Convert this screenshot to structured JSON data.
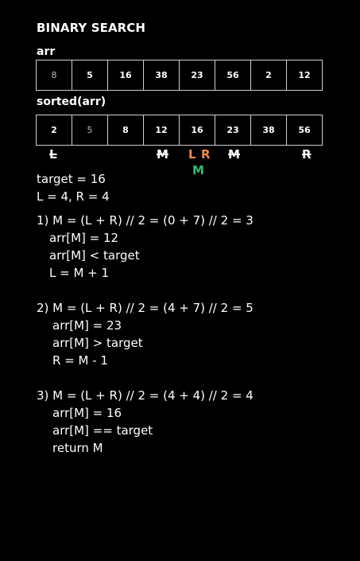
{
  "title": "BINARY SEARCH",
  "arr_label": "arr",
  "sorted_label": "sorted(arr)",
  "arr": [
    "8",
    "5",
    "16",
    "38",
    "23",
    "56",
    "2",
    "12"
  ],
  "sorted": [
    "2",
    "5",
    "8",
    "12",
    "16",
    "23",
    "38",
    "56"
  ],
  "markers": {
    "l_old": "L",
    "m_old1": "M",
    "l_new": "L",
    "r_new": "R",
    "m_final": "M",
    "m_old2": "M",
    "r_old": "R"
  },
  "colors": {
    "orange": "#f08a4b",
    "green": "#2fbf71"
  },
  "target_line": "target = 16",
  "lr_line": "L = 4, R = 4",
  "steps": [
    {
      "head": "1) M = (L + R) // 2 = (0 + 7) // 2 = 3",
      "lines": [
        "arr[M] = 12",
        "arr[M] < target",
        "L = M + 1"
      ]
    },
    {
      "head": "2) M = (L + R) // 2 = (4 + 7) // 2 = 5",
      "lines": [
        "arr[M] = 23",
        "arr[M] > target",
        "R = M - 1"
      ]
    },
    {
      "head": "3) M = (L + R) // 2 = (4 + 4) // 2 = 4",
      "lines": [
        "arr[M] = 16",
        "arr[M] == target",
        "return M"
      ]
    }
  ]
}
